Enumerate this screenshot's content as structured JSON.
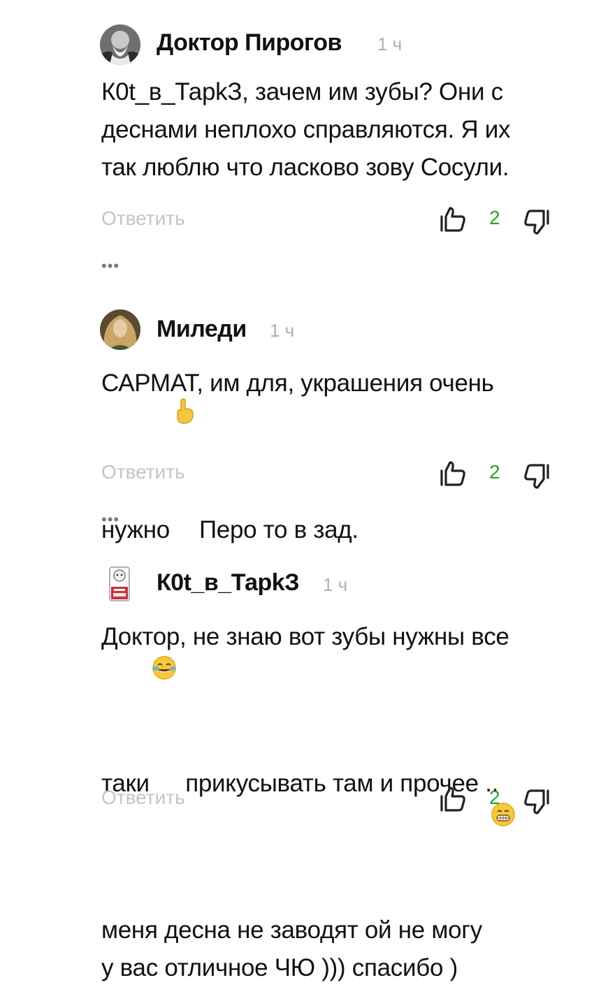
{
  "comments": [
    {
      "author": "Доктор Пирогов",
      "time": "1 ч",
      "text": "К0t_в_ТарkЗ, зачем им зубы? Они с деснами неплохо справляются. Я их так люблю что ласково зову Сосули.",
      "lines": [
        "К0t_в_ТарkЗ, зачем им зубы? Они с",
        "деснами неплохо справляются. Я их",
        "так люблю что ласково зову Сосули."
      ],
      "reply_label": "Ответить",
      "likes": "2",
      "more": "•••"
    },
    {
      "author": "Миледи",
      "time": "1 ч",
      "lines": [
        "САРМАТ, им для, украшения очень",
        "нужно",
        "Перо то в зад."
      ],
      "reply_label": "Ответить",
      "likes": "2",
      "more": "•••"
    },
    {
      "author": "К0t_в_ТарkЗ",
      "time": "1 ч",
      "lines": [
        "Доктор, не знаю вот зубы нужны все",
        "таки",
        "прикусывать там и прочее ..",
        "меня десна не заводят ой не могу",
        "у вас отличное ЧЮ ))) спасибо )"
      ],
      "reply_label": "Ответить",
      "likes": "2"
    }
  ],
  "colors": {
    "like_count": "#2aa12a",
    "reply": "#c4c4c4",
    "time": "#b0b0b0"
  },
  "icons": [
    "thumbs-up-icon",
    "thumbs-down-icon",
    "more-icon",
    "pointing-up-emoji",
    "tears-of-joy-emoji",
    "grinning-emoji"
  ]
}
